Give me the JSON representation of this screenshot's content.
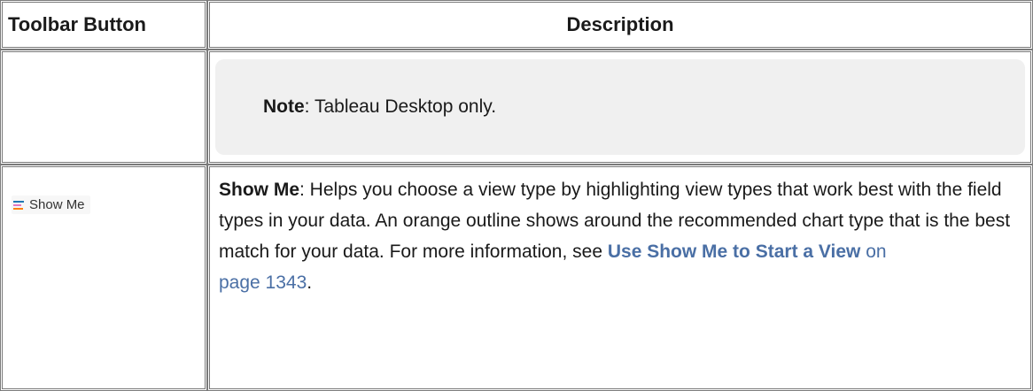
{
  "table": {
    "headers": {
      "col1": "Toolbar Button",
      "col2": "Description"
    },
    "note_row": {
      "label": "Note",
      "text": ": Tableau Desktop only."
    },
    "show_me_row": {
      "button_label": "Show Me",
      "button_icon": "show-me-bars-icon",
      "lead": "Show Me",
      "text_part1": ": Helps you choose a view type by highlighting view types that work best with the field types in your data. An orange outline shows around the recommended chart type that is the best match for your data. For more information, see ",
      "link_text": "Use Show Me to Start a View",
      "page_link_prefix": " on",
      "page_link": "page 1343",
      "trailing": "."
    }
  },
  "colors": {
    "link": "#4a6fa5",
    "note_bg": "#f0f0f0",
    "icon_bar_1": "#1f77b4",
    "icon_bar_2": "#e377c2",
    "icon_bar_3": "#ff7f0e"
  }
}
